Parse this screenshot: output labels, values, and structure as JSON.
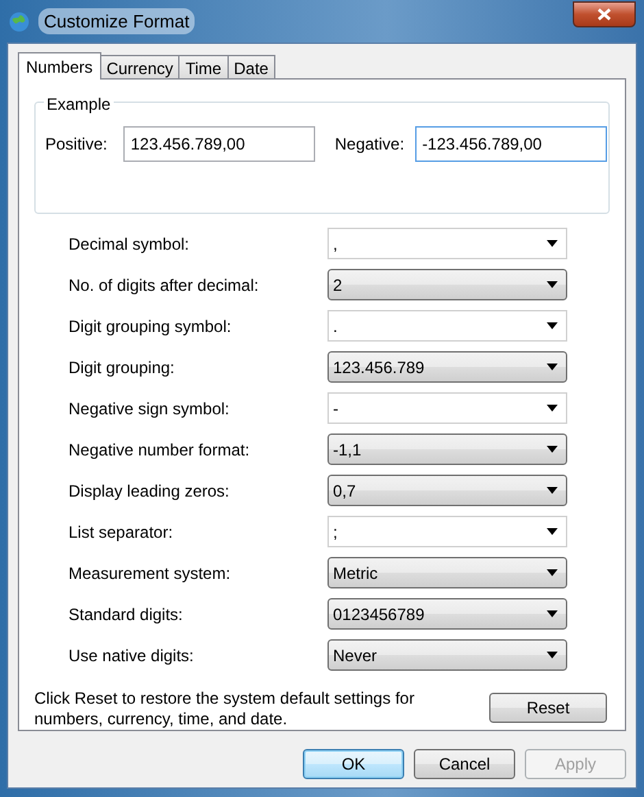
{
  "window": {
    "title": "Customize Format"
  },
  "tabs": [
    {
      "label": "Numbers",
      "selected": true
    },
    {
      "label": "Currency",
      "selected": false
    },
    {
      "label": "Time",
      "selected": false
    },
    {
      "label": "Date",
      "selected": false
    }
  ],
  "example": {
    "title": "Example",
    "positive_label": "Positive:",
    "positive_value": "123.456.789,00",
    "negative_label": "Negative:",
    "negative_value": "-123.456.789,00"
  },
  "settings": [
    {
      "label": "Decimal symbol:",
      "value": ",",
      "kind": "editable"
    },
    {
      "label": "No. of digits after decimal:",
      "value": "2",
      "kind": "list"
    },
    {
      "label": "Digit grouping symbol:",
      "value": ".",
      "kind": "editable"
    },
    {
      "label": "Digit grouping:",
      "value": "123.456.789",
      "kind": "list"
    },
    {
      "label": "Negative sign symbol:",
      "value": "-",
      "kind": "editable"
    },
    {
      "label": "Negative number format:",
      "value": "-1,1",
      "kind": "list"
    },
    {
      "label": "Display leading zeros:",
      "value": "0,7",
      "kind": "list"
    },
    {
      "label": "List separator:",
      "value": ";",
      "kind": "editable"
    },
    {
      "label": "Measurement system:",
      "value": "Metric",
      "kind": "list"
    },
    {
      "label": "Standard digits:",
      "value": "0123456789",
      "kind": "list"
    },
    {
      "label": "Use native digits:",
      "value": "Never",
      "kind": "list"
    }
  ],
  "reset_note": "Click Reset to restore the system default settings for numbers, currency, time, and date.",
  "reset_button": "Reset",
  "buttons": [
    {
      "label": "OK",
      "disabled": false,
      "default": true
    },
    {
      "label": "Cancel",
      "disabled": false,
      "default": false
    },
    {
      "label": "Apply",
      "disabled": true,
      "default": false
    }
  ]
}
